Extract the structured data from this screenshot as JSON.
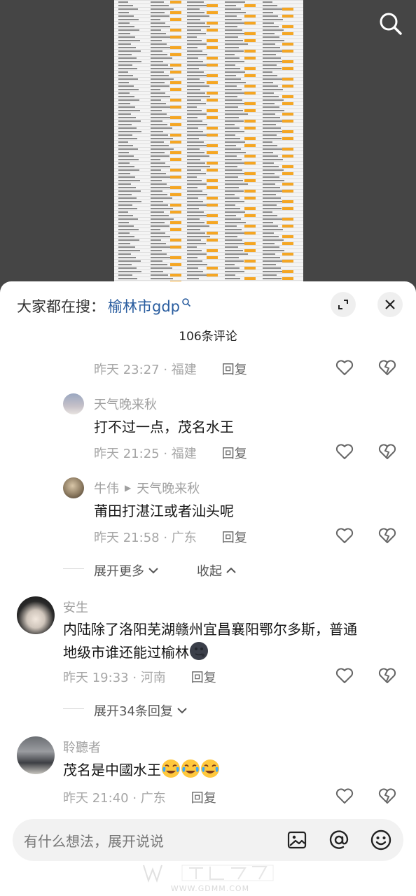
{
  "search": {
    "prefix": "大家都在搜：",
    "query": "榆林市gdp"
  },
  "comment_count": "106条评论",
  "comments": [
    {
      "time": "昨天 23:27 · 福建",
      "reply": "回复"
    },
    {
      "user": "天气晚来秋",
      "text": "打不过一点，茂名水王",
      "time": "昨天 21:25 · 福建",
      "reply": "回复"
    },
    {
      "user": "牛伟",
      "reply_to": "天气晚来秋",
      "text": "莆田打湛江或者汕头呢",
      "time": "昨天 21:58 · 广东",
      "reply": "回复"
    },
    {
      "user": "安生",
      "text_line1": "内陆除了洛阳芜湖赣州宜昌襄阳鄂尔多斯，普通",
      "text_line2": "地级市谁还能过榆林",
      "time": "昨天 19:33 · 河南",
      "reply": "回复"
    },
    {
      "user": "聆聽者",
      "text": "茂名是中國水王",
      "time": "昨天 21:40 · 广东",
      "reply": "回复"
    }
  ],
  "controls": {
    "expand_more": "展开更多",
    "collapse": "收起",
    "expand_replies": "展开34条回复"
  },
  "input": {
    "placeholder": "有什么想法，展开说说"
  },
  "watermark": "WWW.GDMM.COM",
  "colors": {
    "link": "#2a5d9f",
    "highlight": "#f5a623"
  }
}
